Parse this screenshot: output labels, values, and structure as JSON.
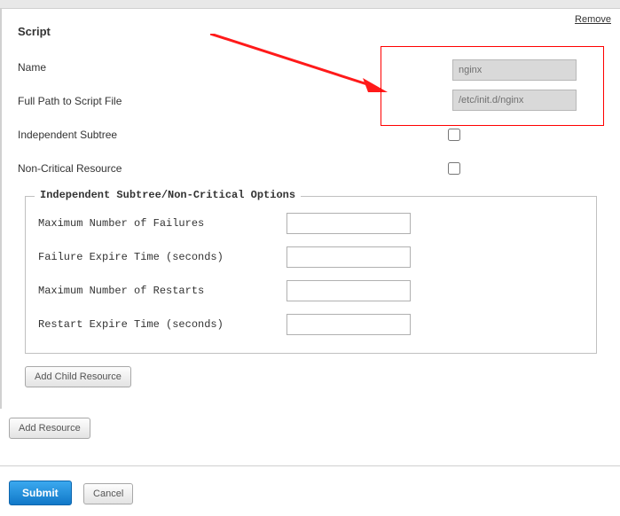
{
  "header": {
    "remove_link": "Remove"
  },
  "script": {
    "title": "Script",
    "name_label": "Name",
    "name_value": "nginx",
    "path_label": "Full Path to Script File",
    "path_value": "/etc/init.d/nginx",
    "independent_label": "Independent Subtree",
    "noncritical_label": "Non-Critical Resource"
  },
  "options": {
    "legend": "Independent Subtree/Non-Critical Options",
    "max_failures_label": "Maximum Number of Failures",
    "max_failures_value": "",
    "failure_expire_label": "Failure Expire Time (seconds)",
    "failure_expire_value": "",
    "max_restarts_label": "Maximum Number of Restarts",
    "max_restarts_value": "",
    "restart_expire_label": "Restart Expire Time (seconds)",
    "restart_expire_value": ""
  },
  "buttons": {
    "add_child": "Add Child Resource",
    "add_resource": "Add Resource",
    "submit": "Submit",
    "cancel": "Cancel"
  }
}
